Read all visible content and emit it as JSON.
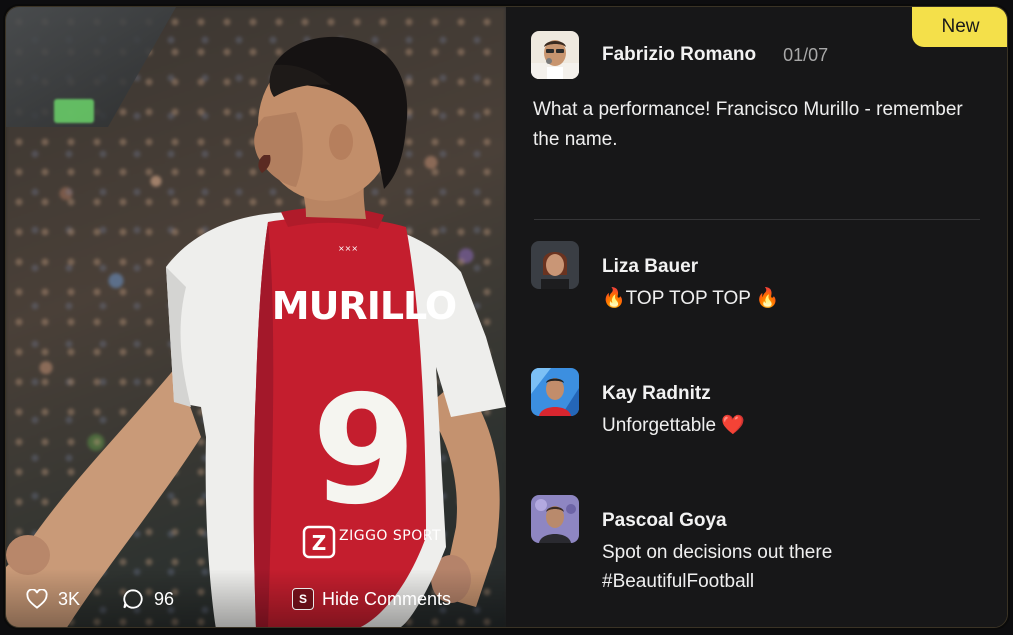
{
  "post": {
    "badge": "New",
    "author": "Fabrizio Romano",
    "date": "01/07",
    "text": "What a performance! Francisco Murillo - remember the name.",
    "player_name": "MURILLO",
    "player_number": "9",
    "sponsor": "ZIGGO SPORT"
  },
  "stats": {
    "likes": "3K",
    "comments": "96",
    "hide_key": "S",
    "hide_label": "Hide Comments"
  },
  "comments": [
    {
      "author": "Liza Bauer",
      "text": "🔥TOP TOP TOP 🔥"
    },
    {
      "author": "Kay Radnitz",
      "text": "Unforgettable ❤️"
    },
    {
      "author": "Pascoal Goya",
      "text": "Spot on decisions out there #BeautifulFootball"
    }
  ],
  "icons": {
    "likes": "heart-icon",
    "comments": "speech-bubble-icon",
    "hide": "keyboard-key-icon"
  },
  "colors": {
    "badge": "#f4e04a",
    "panel": "#171718",
    "jersey_red": "#c41e2e",
    "heart": "#e0303c"
  }
}
